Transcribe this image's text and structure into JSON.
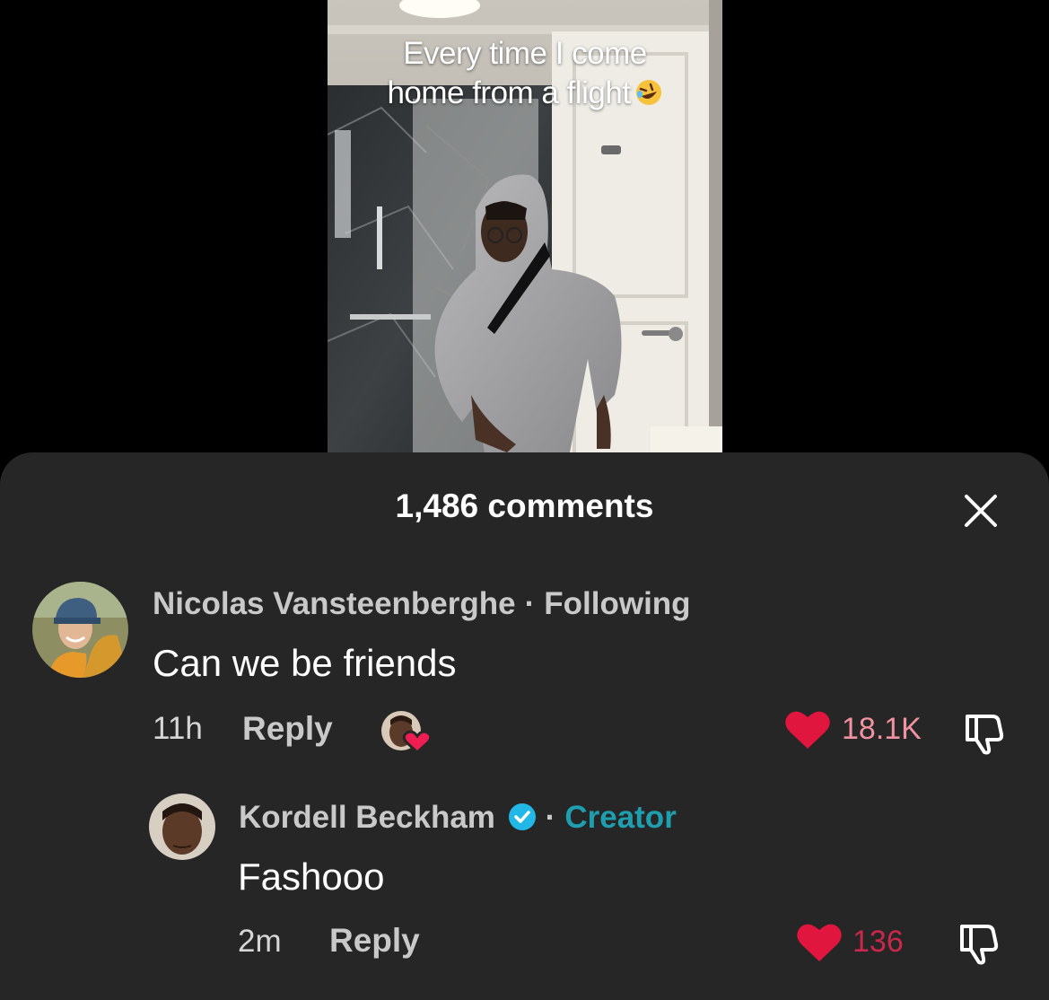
{
  "video": {
    "caption_line1": "Every time I come",
    "caption_line2": "home from a flight",
    "caption_emoji": "rolling-on-floor-laughing-emoji"
  },
  "comments_sheet": {
    "title": "1,486 comments",
    "close_icon": "close-icon",
    "comments": [
      {
        "username": "Nicolas Vansteenberghe",
        "separator": "·",
        "tag": "Following",
        "text": "Can we be friends",
        "time": "11h",
        "reply_label": "Reply",
        "liked_by_creator": true,
        "likes": "18.1K",
        "like_color": "#e0163f",
        "likes_text_color": "#f0929f"
      },
      {
        "username": "Kordell Beckham",
        "verified": true,
        "separator": "·",
        "tag": "Creator",
        "text": "Fashooo",
        "time": "2m",
        "reply_label": "Reply",
        "likes": "136",
        "like_color": "#e0163f",
        "likes_text_color": "#c9284a"
      }
    ]
  },
  "colors": {
    "sheet_background": "#262626",
    "creator_tag": "#1e9fb0",
    "verified_badge": "#21b8e8"
  }
}
